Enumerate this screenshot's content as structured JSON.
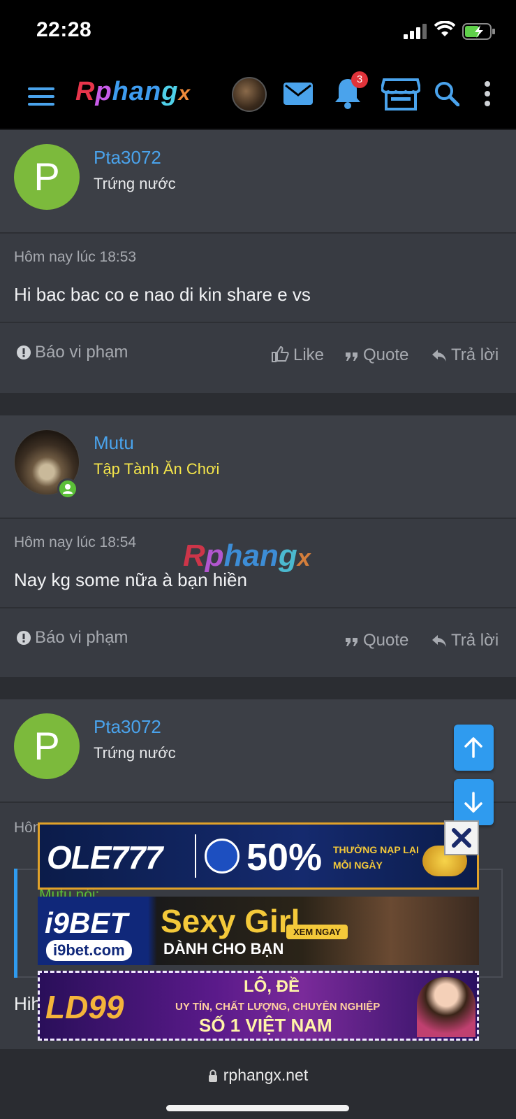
{
  "status_bar": {
    "time": "22:28"
  },
  "nav": {
    "logo": {
      "p1": "R",
      "p2": "p",
      "p3": "han",
      "p4": "g",
      "p5": "x"
    },
    "notification_count": "3"
  },
  "posts": [
    {
      "username": "Pta3072",
      "avatar_letter": "P",
      "user_title": "Trứng nước",
      "time": "Hôm nay lúc 18:53",
      "text": "Hi bac bac co e nao di kin share e vs",
      "report": "Báo vi phạm",
      "like": "Like",
      "quote": "Quote",
      "reply": "Trả lời"
    },
    {
      "username": "Mutu",
      "user_title": "Tập Tành Ăn Chơi",
      "time": "Hôm nay lúc 18:54",
      "text": "Nay kg some nữa à bạn hiền",
      "report": "Báo vi phạm",
      "quote": "Quote",
      "reply": "Trả lời"
    },
    {
      "username": "Pta3072",
      "avatar_letter": "P",
      "user_title": "Trứng nước",
      "time_partial": "Hôn",
      "quote_partial": "Mutu nói:",
      "text_partial": "Hih"
    }
  ],
  "ads": {
    "ad1": {
      "brand": "OLE777",
      "percent": "50%",
      "line1": "THƯỞNG NẠP LẠI",
      "line2": "MỖI NGÀY"
    },
    "ad2": {
      "brand": "i9BET",
      "site": "i9bet.com",
      "title": "Sexy Girl",
      "subtitle": "DÀNH CHO BẠN",
      "cta": "XEM NGAY"
    },
    "ad3": {
      "brand": "LD99",
      "line1": "LÔ, ĐỀ",
      "line2": "UY TÍN, CHẤT LƯỢNG, CHUYÊN NGHIỆP",
      "line3": "SỐ 1 VIỆT NAM"
    }
  },
  "browser": {
    "url": "rphangx.net"
  }
}
